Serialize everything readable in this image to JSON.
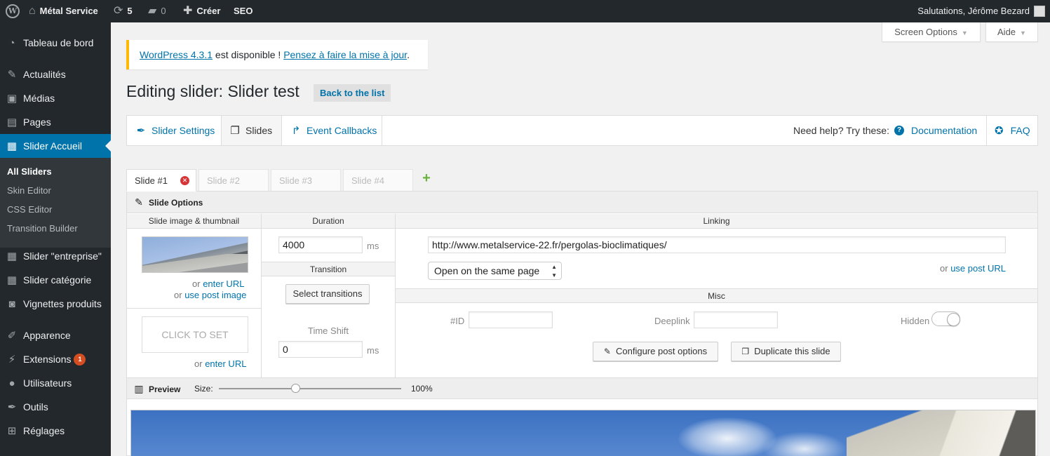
{
  "adminbar": {
    "site_name": "Métal Service",
    "updates_count": "5",
    "comments_count": "0",
    "new_label": "Créer",
    "seo_label": "SEO",
    "greeting": "Salutations, Jérôme Bezard"
  },
  "sidebar": {
    "items": [
      {
        "label": "Tableau de bord",
        "icon": "dashboard-icon"
      },
      {
        "label": "Actualités",
        "icon": "pin-icon"
      },
      {
        "label": "Médias",
        "icon": "media-icon"
      },
      {
        "label": "Pages",
        "icon": "page-icon"
      },
      {
        "label": "Slider Accueil",
        "icon": "slider-icon"
      },
      {
        "label": "Slider \"entreprise\"",
        "icon": "slider-icon"
      },
      {
        "label": "Slider catégorie",
        "icon": "slider-icon"
      },
      {
        "label": "Vignettes produits",
        "icon": "camera-icon"
      },
      {
        "label": "Apparence",
        "icon": "brush-icon"
      },
      {
        "label": "Extensions",
        "icon": "plugin-icon",
        "badge": "1"
      },
      {
        "label": "Utilisateurs",
        "icon": "user-icon"
      },
      {
        "label": "Outils",
        "icon": "wrench-icon"
      },
      {
        "label": "Réglages",
        "icon": "settings-icon"
      }
    ],
    "submenu": [
      "All Sliders",
      "Skin Editor",
      "CSS Editor",
      "Transition Builder"
    ]
  },
  "screen_options_label": "Screen Options",
  "help_label": "Aide",
  "notice": {
    "link1": "WordPress 4.3.1",
    "middle": " est disponible ! ",
    "link2": "Pensez à faire la mise à jour",
    "end": "."
  },
  "page_title": "Editing slider: Slider test",
  "back_button": "Back to the list",
  "nav": {
    "tabs": [
      "Slider Settings",
      "Slides",
      "Event Callbacks"
    ],
    "help_text": "Need help? Try these:",
    "documentation": "Documentation",
    "faq": "FAQ"
  },
  "slide_tabs": [
    "Slide #1",
    "Slide #2",
    "Slide #3",
    "Slide #4"
  ],
  "slide_options": {
    "title": "Slide Options",
    "col_image": "Slide image & thumbnail",
    "col_duration": "Duration",
    "col_linking": "Linking",
    "or": "or",
    "enter_url": "enter URL",
    "use_post_image": "use post image",
    "click_to_set": "CLICK TO SET",
    "duration_value": "4000",
    "ms": "ms",
    "transition_head": "Transition",
    "select_transitions": "Select transitions",
    "time_shift_label": "Time Shift",
    "time_shift_value": "0",
    "link_url": "http://www.metalservice-22.fr/pergolas-bioclimatiques/",
    "link_target": "Open on the same page",
    "use_post_url": "use post URL",
    "misc_head": "Misc",
    "id_label": "#ID",
    "deeplink_label": "Deeplink",
    "hidden_label": "Hidden",
    "configure_post_options": "Configure post options",
    "duplicate_slide": "Duplicate this slide"
  },
  "preview": {
    "title": "Preview",
    "size_label": "Size:",
    "size_value": "100%",
    "size_fraction": 0.42
  },
  "colors": {
    "admin_bg": "#23282d",
    "accent": "#0073aa",
    "notice_border": "#ffb900",
    "badge": "#d54e21",
    "add_green": "#69b43c"
  }
}
